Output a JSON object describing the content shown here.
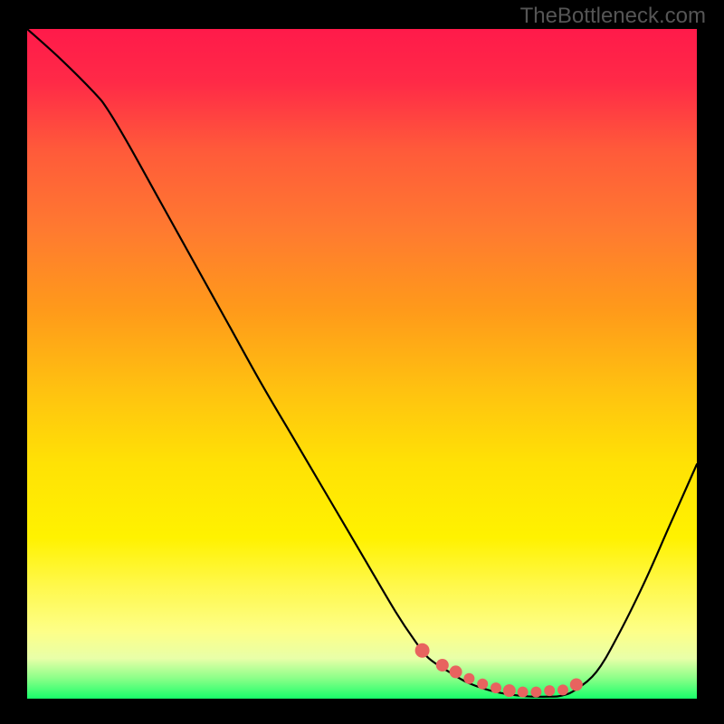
{
  "watermark": "TheBottleneck.com",
  "chart_data": {
    "type": "line",
    "title": "",
    "xlabel": "",
    "ylabel": "",
    "xlim": [
      0,
      1
    ],
    "ylim": [
      0,
      1
    ],
    "series": [
      {
        "name": "curve",
        "x": [
          0.0,
          0.05,
          0.1,
          0.12,
          0.15,
          0.2,
          0.25,
          0.3,
          0.35,
          0.4,
          0.45,
          0.5,
          0.55,
          0.58,
          0.6,
          0.63,
          0.66,
          0.7,
          0.74,
          0.78,
          0.8,
          0.82,
          0.85,
          0.88,
          0.92,
          0.96,
          1.0
        ],
        "y": [
          1.0,
          0.955,
          0.905,
          0.88,
          0.83,
          0.74,
          0.65,
          0.56,
          0.47,
          0.385,
          0.3,
          0.215,
          0.13,
          0.085,
          0.06,
          0.04,
          0.023,
          0.01,
          0.004,
          0.003,
          0.005,
          0.014,
          0.04,
          0.09,
          0.17,
          0.26,
          0.35
        ]
      }
    ],
    "trough_markers": {
      "x": [
        0.59,
        0.62,
        0.64,
        0.66,
        0.68,
        0.7,
        0.72,
        0.74,
        0.76,
        0.78,
        0.8,
        0.82
      ],
      "y": [
        0.072,
        0.05,
        0.04,
        0.03,
        0.022,
        0.016,
        0.012,
        0.01,
        0.01,
        0.012,
        0.013,
        0.021
      ],
      "radius": [
        8,
        7,
        7,
        6,
        6,
        6,
        7,
        6,
        6,
        6,
        6,
        7
      ]
    },
    "colors": {
      "gradient_top": "#ff1a4a",
      "gradient_mid": "#ffe205",
      "gradient_bottom": "#18ff6a",
      "curve": "#000000",
      "markers": "#e8635f"
    }
  }
}
